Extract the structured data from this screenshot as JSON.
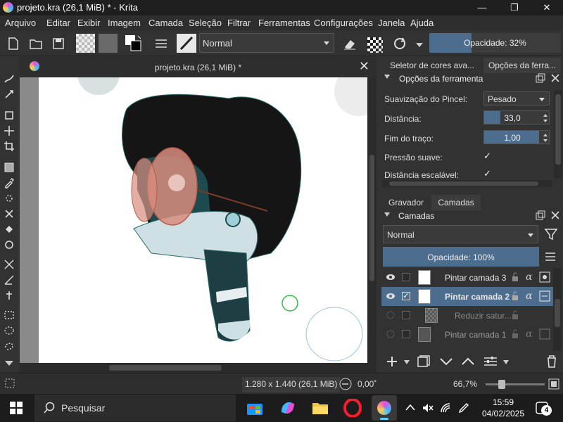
{
  "window": {
    "title": "projeto.kra (26,1 MiB) * - Krita",
    "minimize": "—",
    "maximize": "❐",
    "close": "✕"
  },
  "menu": [
    "Arquivo",
    "Editar",
    "Exibir",
    "Imagem",
    "Camada",
    "Seleção",
    "Filtrar",
    "Ferramentas",
    "Configurações",
    "Janela",
    "Ajuda"
  ],
  "toolbar": {
    "blend_mode": "Normal",
    "opacity_label": "Opacidade: 32%",
    "opacity_value": 0.32
  },
  "document": {
    "tab_title": "projeto.kra (26,1 MiB) *",
    "close": "✕"
  },
  "dock_top": {
    "tabs": [
      "Seletor de cores ava...",
      "Opções da ferra..."
    ],
    "title": "Opções da ferramenta",
    "props": {
      "smoothing_label": "Suavização do Pincel:",
      "smoothing_value": "Pesado",
      "distance_label": "Distância:",
      "distance_value": "33,0",
      "end_label": "Fim do traço:",
      "end_value": "1,00",
      "pressure_label": "Pressão suave:",
      "pressure_check": "✓",
      "scalable_label": "Distância escalável:",
      "scalable_check": "✓"
    }
  },
  "dock_bottom": {
    "tabs": [
      "Gravador",
      "Camadas"
    ],
    "title": "Camadas",
    "blend_mode": "Normal",
    "opacity_label": "Opacidade:  100%",
    "opacity_value": 1.0,
    "layers": [
      {
        "name": "Pintar camada 3"
      },
      {
        "name": "Pintar camada 2"
      },
      {
        "name": "Reduzir satur..."
      },
      {
        "name": "Pintar camada 1"
      }
    ]
  },
  "status": {
    "dimensions": "1.280 x 1.440 (26,1 MiB)",
    "rotation": "0,00˚",
    "zoom": "66,7%"
  },
  "taskbar": {
    "search_placeholder": "Pesquisar",
    "time": "15:59",
    "date": "04/02/2025",
    "notifications": "4"
  },
  "colors": {
    "accent": "#4d6d8f",
    "background": "#2b2b2b"
  }
}
